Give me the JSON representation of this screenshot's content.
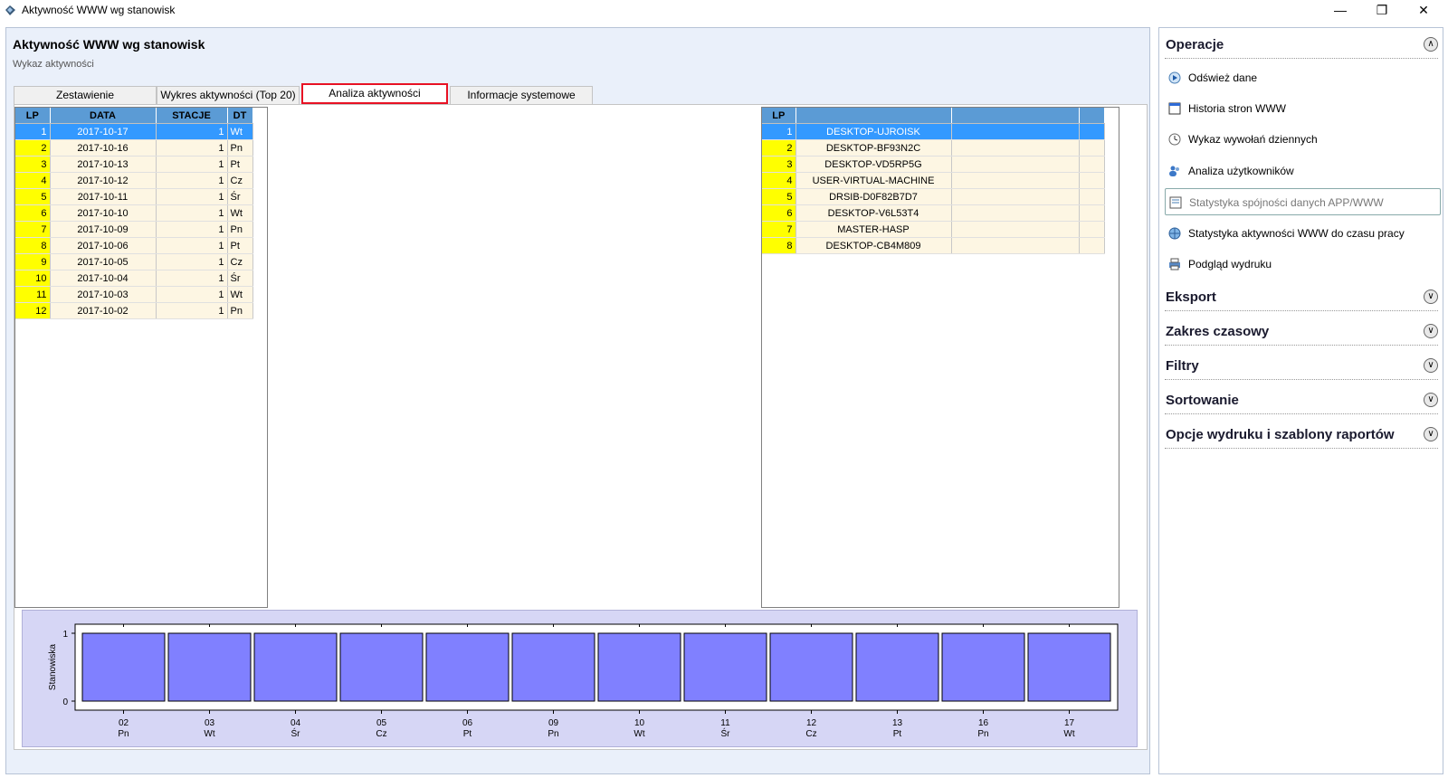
{
  "window": {
    "title": "Aktywność WWW wg stanowisk",
    "minimize": "—",
    "maximize": "❐",
    "close": "✕"
  },
  "header": {
    "title": "Aktywność WWW wg stanowisk",
    "subtitle": "Wykaz aktywności"
  },
  "tabs": [
    {
      "label": "Zestawienie"
    },
    {
      "label": "Wykres aktywności (Top 20)"
    },
    {
      "label": "Analiza aktywności"
    },
    {
      "label": "Informacje systemowe"
    }
  ],
  "dates_table": {
    "columns": [
      "LP",
      "DATA",
      "STACJE",
      "DT"
    ],
    "rows": [
      [
        "1",
        "2017-10-17",
        "1",
        "Wt"
      ],
      [
        "2",
        "2017-10-16",
        "1",
        "Pn"
      ],
      [
        "3",
        "2017-10-13",
        "1",
        "Pt"
      ],
      [
        "4",
        "2017-10-12",
        "1",
        "Cz"
      ],
      [
        "5",
        "2017-10-11",
        "1",
        "Śr"
      ],
      [
        "6",
        "2017-10-10",
        "1",
        "Wt"
      ],
      [
        "7",
        "2017-10-09",
        "1",
        "Pn"
      ],
      [
        "8",
        "2017-10-06",
        "1",
        "Pt"
      ],
      [
        "9",
        "2017-10-05",
        "1",
        "Cz"
      ],
      [
        "10",
        "2017-10-04",
        "1",
        "Śr"
      ],
      [
        "11",
        "2017-10-03",
        "1",
        "Wt"
      ],
      [
        "12",
        "2017-10-02",
        "1",
        "Pn"
      ]
    ]
  },
  "stations_table": {
    "columns": [
      "LP",
      "",
      ""
    ],
    "rows": [
      [
        "1",
        "DESKTOP-UJROISK"
      ],
      [
        "2",
        "DESKTOP-BF93N2C"
      ],
      [
        "3",
        "DESKTOP-VD5RP5G"
      ],
      [
        "4",
        "USER-VIRTUAL-MACHINE"
      ],
      [
        "5",
        "DRSIB-D0F82B7D7"
      ],
      [
        "6",
        "DESKTOP-V6L53T4"
      ],
      [
        "7",
        "MASTER-HASP"
      ],
      [
        "8",
        "DESKTOP-CB4M809"
      ]
    ]
  },
  "chart_data": {
    "type": "bar",
    "categories": [
      "02",
      "03",
      "04",
      "05",
      "06",
      "09",
      "10",
      "11",
      "12",
      "13",
      "16",
      "17"
    ],
    "category_days": [
      "Pn",
      "Wt",
      "Śr",
      "Cz",
      "Pt",
      "Pn",
      "Wt",
      "Śr",
      "Cz",
      "Pt",
      "Pn",
      "Wt"
    ],
    "values": [
      1,
      1,
      1,
      1,
      1,
      1,
      1,
      1,
      1,
      1,
      1,
      1
    ],
    "ylabel": "Stanowiska",
    "xlabel": "",
    "ylim": [
      0,
      1
    ],
    "yticks": [
      "0",
      "1"
    ],
    "bar_color": "#8080ff",
    "background": "#d6d6f5"
  },
  "sidebar": {
    "sections": [
      {
        "label": "Operacje",
        "expanded": true
      },
      {
        "label": "Eksport",
        "expanded": false
      },
      {
        "label": "Zakres czasowy",
        "expanded": false
      },
      {
        "label": "Filtry",
        "expanded": false
      },
      {
        "label": "Sortowanie",
        "expanded": false
      },
      {
        "label": "Opcje wydruku i szablony raportów",
        "expanded": false
      }
    ],
    "chevron_up": "∧",
    "chevron_down": "∨",
    "operations": [
      {
        "label": "Odśwież dane",
        "icon": "play-icon"
      },
      {
        "label": "Historia stron WWW",
        "icon": "window-icon"
      },
      {
        "label": "Wykaz wywołań dziennych",
        "icon": "clock-icon"
      },
      {
        "label": "Analiza użytkowników",
        "icon": "users-icon"
      },
      {
        "label": "Statystyka spójności danych APP/WWW",
        "icon": "document-icon"
      },
      {
        "label": "Statystyka aktywności WWW do czasu pracy",
        "icon": "globe-icon"
      },
      {
        "label": "Podgląd wydruku",
        "icon": "printer-icon"
      }
    ]
  }
}
